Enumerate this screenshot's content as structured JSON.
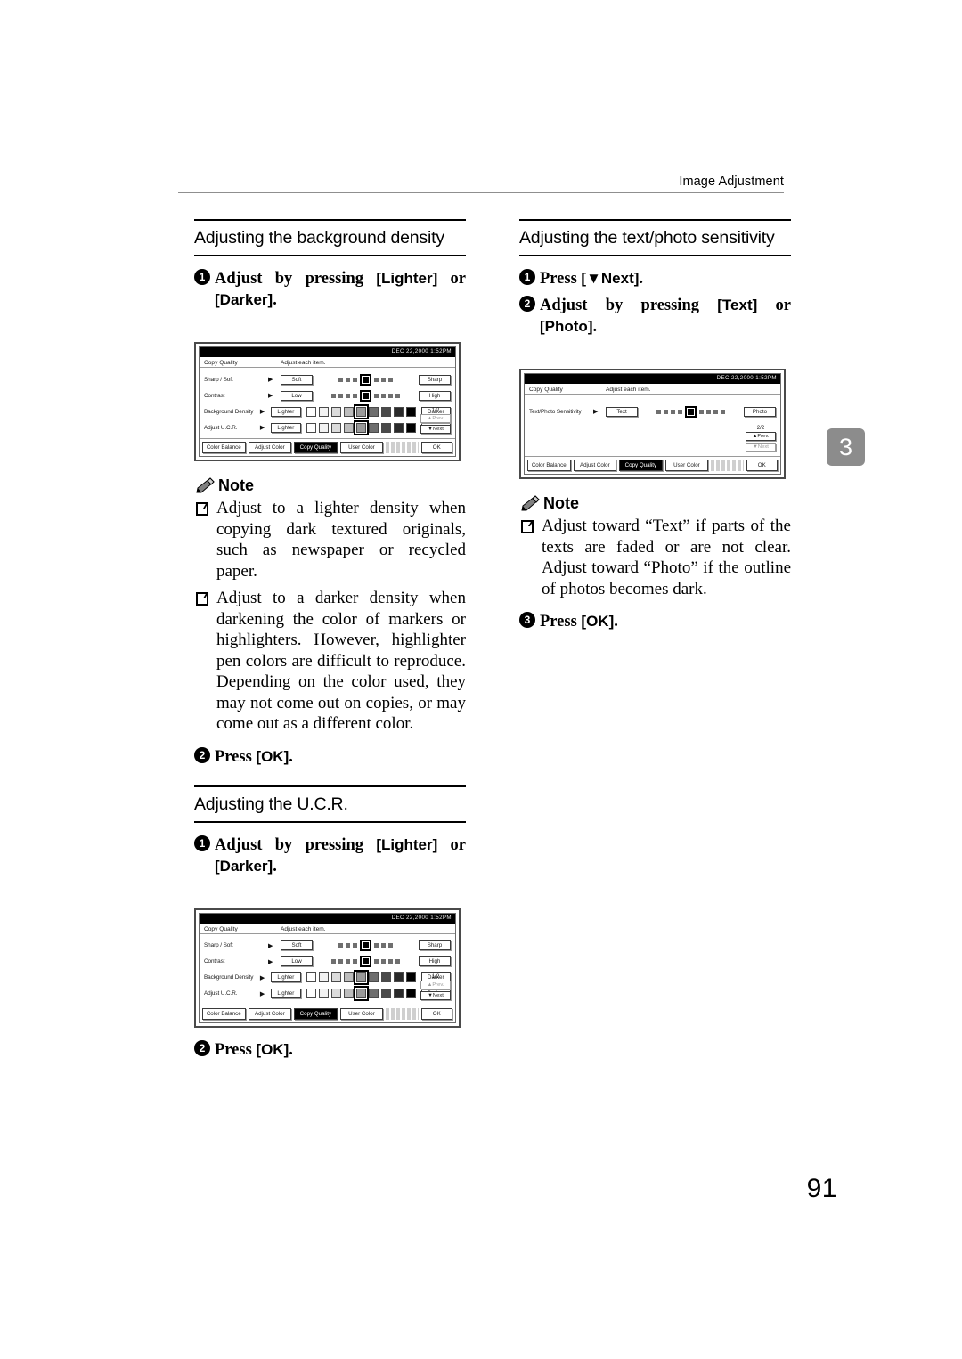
{
  "header": {
    "running_title": "Image Adjustment"
  },
  "chapter_tab": "3",
  "folio": "91",
  "left_column": {
    "section1": {
      "title": "Adjusting the background density",
      "steps": [
        {
          "num": "1",
          "text_before": "Adjust by pressing ",
          "btn1": "[Lighter]",
          "mid": " or ",
          "btn2": "[Darker]",
          "after": "."
        },
        {
          "num": "2",
          "text_before": "Press ",
          "btn1": "[OK]",
          "mid": "",
          "btn2": "",
          "after": "."
        }
      ],
      "note": {
        "heading": "Note",
        "items": [
          "Adjust to a lighter density when copying dark textured originals, such as newspaper or recycled paper.",
          "Adjust to a darker density when darkening the color of markers or highlighters. However, highlighter pen colors are difficult to reproduce. Depending on the color used, they may not come out on copies, or may come out as a different color."
        ]
      }
    },
    "section2": {
      "title": "Adjusting the U.C.R.",
      "steps": [
        {
          "num": "1",
          "text_before": "Adjust by pressing ",
          "btn1": "[Lighter]",
          "mid": " or ",
          "btn2": "[Darker]",
          "after": "."
        },
        {
          "num": "2",
          "text_before": "Press ",
          "btn1": "[OK]",
          "mid": "",
          "btn2": "",
          "after": "."
        }
      ]
    }
  },
  "right_column": {
    "section1": {
      "title": "Adjusting the text/photo sensitivity",
      "steps": [
        {
          "num": "1",
          "text_before": "Press ",
          "btn1": "[▼Next]",
          "mid": "",
          "btn2": "",
          "after": "."
        },
        {
          "num": "2",
          "text_before": "Adjust by pressing ",
          "btn1": "[Text]",
          "mid": " or ",
          "btn2": "[Photo]",
          "after": "."
        },
        {
          "num": "3",
          "text_before": "Press ",
          "btn1": "[OK]",
          "mid": "",
          "btn2": "",
          "after": "."
        }
      ],
      "note": {
        "heading": "Note",
        "items": [
          "Adjust toward “Text” if parts of the texts are faded or are not clear. Adjust toward “Photo” if the outline of photos becomes dark."
        ]
      }
    }
  },
  "lcd_panels": {
    "copy_quality": {
      "stamp": "DEC  22,2000  1:52PM",
      "screen_title": "Copy Quality",
      "instruction": "Adjust each item.",
      "rows": [
        {
          "label": "Sharp / Soft",
          "left_key": "Soft",
          "right_key": "Sharp",
          "type": "dots",
          "count": 7,
          "selected": 4
        },
        {
          "label": "Contrast",
          "left_key": "Low",
          "right_key": "High",
          "type": "dots",
          "count": 9,
          "selected": 5
        },
        {
          "label": "Background Density",
          "left_key": "Lighter",
          "right_key": "Darker",
          "type": "swatches",
          "count": 9,
          "selected": 5
        },
        {
          "label": "Adjust U.C.R.",
          "left_key": "Lighter",
          "right_key": "Darker",
          "type": "swatches",
          "count": 9,
          "selected": 5
        }
      ],
      "pager": {
        "page": "1/2",
        "prev": "Prev.",
        "next": "Next"
      },
      "tabs": [
        {
          "label": "Color Balance",
          "active": false
        },
        {
          "label": "Adjust Color",
          "active": false
        },
        {
          "label": "Copy Quality",
          "active": true
        },
        {
          "label": "User Color",
          "active": false
        }
      ],
      "ok": "OK"
    },
    "text_photo": {
      "stamp": "DEC  22,2000  1:52PM",
      "screen_title": "Copy Quality",
      "instruction": "Adjust each item.",
      "rows": [
        {
          "label": "Text/Photo Sensitivity",
          "left_key": "Text",
          "right_key": "Photo",
          "type": "dots",
          "count": 9,
          "selected": 5
        }
      ],
      "pager": {
        "page": "2/2",
        "prev": "Prev.",
        "next": "Next"
      },
      "tabs": [
        {
          "label": "Color Balance",
          "active": false
        },
        {
          "label": "Adjust Color",
          "active": false
        },
        {
          "label": "Copy Quality",
          "active": true
        },
        {
          "label": "User Color",
          "active": false
        }
      ],
      "ok": "OK"
    }
  }
}
